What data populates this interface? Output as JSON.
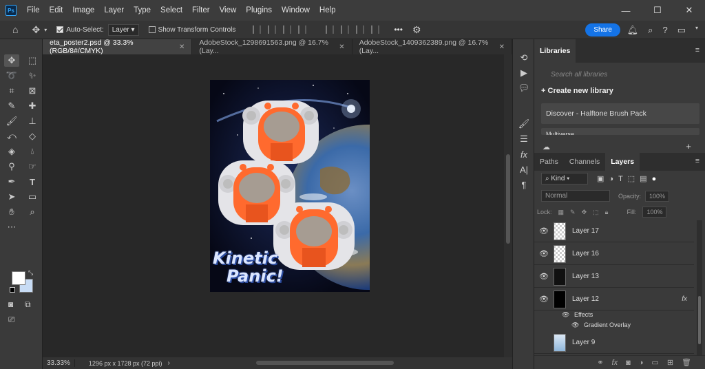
{
  "app": {
    "logo": "Ps",
    "menu": [
      "File",
      "Edit",
      "Image",
      "Layer",
      "Type",
      "Select",
      "Filter",
      "View",
      "Plugins",
      "Window",
      "Help"
    ],
    "window_controls": [
      "minimize-icon",
      "maximize-icon",
      "close-icon"
    ]
  },
  "options": {
    "auto_select_label": "Auto-Select:",
    "auto_select_value": "Layer",
    "transform_label": "Show Transform Controls",
    "share_label": "Share",
    "more_label": "•••"
  },
  "tabs": [
    {
      "label": "eta_poster2.psd @ 33.3% (RGB/8#/CMYK)",
      "active": true
    },
    {
      "label": "AdobeStock_1298691563.png @ 16.7% (Lay...",
      "active": false
    },
    {
      "label": "AdobeStock_1409362389.png @ 16.7% (Lay...",
      "active": false
    }
  ],
  "poster": {
    "title_line1": "Kinetic",
    "title_line2": "Panic!"
  },
  "status": {
    "zoom": "33.33%",
    "doc_info": "1296 px x 1728 px (72 ppi)"
  },
  "libraries": {
    "tab_label": "Libraries",
    "search_placeholder": "Search all libraries",
    "create_label": "Create new library",
    "card_label": "Discover - Halftone Brush Pack",
    "card2_label": "Multiverse"
  },
  "layers_panel": {
    "tabs": [
      "Paths",
      "Channels",
      "Layers"
    ],
    "filter_label": "Kind",
    "blend_mode": "Normal",
    "opacity_label": "Opacity:",
    "opacity_value": "100%",
    "lock_label": "Lock:",
    "fill_label": "Fill:",
    "fill_value": "100%",
    "layers": [
      {
        "name": "Layer 17",
        "thumb": "checker"
      },
      {
        "name": "Layer 16",
        "thumb": "checker"
      },
      {
        "name": "Layer 13",
        "thumb": "stars"
      },
      {
        "name": "Layer 12",
        "thumb": "black",
        "fx": "fx"
      },
      {
        "name": "Layer 9",
        "thumb": "sky"
      }
    ],
    "effects_label": "Effects",
    "gradient_overlay_label": "Gradient Overlay"
  },
  "colors": {
    "accent": "#1473e6",
    "foreground": "#ffffff",
    "background": "#c8dcf5",
    "suit_orange": "#ff6a2e"
  }
}
